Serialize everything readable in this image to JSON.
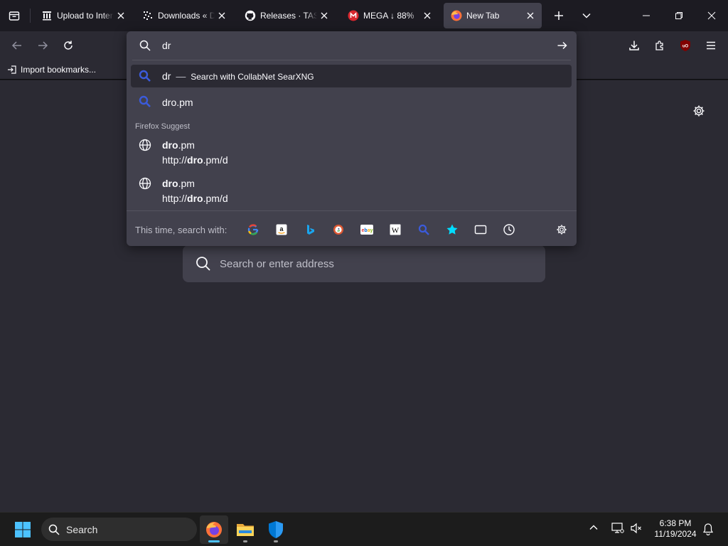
{
  "tabs": [
    {
      "title": "Upload to Internet Archive",
      "icon": "archive-icon"
    },
    {
      "title": "Downloads « Dev",
      "icon": "pixel-grid-icon"
    },
    {
      "title": "Releases · TASEmulators",
      "icon": "github-icon"
    },
    {
      "title": "MEGA ↓ 88%",
      "icon": "mega-icon"
    },
    {
      "title": "New Tab",
      "icon": "firefox-icon",
      "active": true
    }
  ],
  "bookmarks": {
    "import_label": "Import bookmarks..."
  },
  "urlbar": {
    "value": "dr",
    "results": [
      {
        "query": "dr",
        "separator": "—",
        "action": "Search with CollabNet SearXNG"
      },
      {
        "text": "dro.pm"
      }
    ],
    "group_label": "Firefox Suggest",
    "suggestions": [
      {
        "bold": "dro",
        "rest": ".pm",
        "url_prefix": "http://",
        "url_bold": "dro",
        "url_rest": ".pm/d"
      },
      {
        "bold": "dro",
        "rest": ".pm",
        "url_prefix": "http://",
        "url_bold": "dro",
        "url_rest": ".pm/d"
      }
    ],
    "footer_label": "This time, search with:",
    "engines": [
      "google-icon",
      "amazon-icon",
      "bing-icon",
      "duckduckgo-icon",
      "ebay-icon",
      "wikipedia-icon",
      "searxng-icon",
      "bookmarks-star-icon",
      "tabs-icon",
      "history-icon"
    ]
  },
  "center_search": {
    "placeholder": "Search or enter address"
  },
  "taskbar": {
    "search_label": "Search",
    "time": "6:38 PM",
    "date": "11/19/2024"
  },
  "colors": {
    "accent": "#00ddff",
    "search_blue": "#3b5bdb",
    "tab_active": "#42414d"
  }
}
